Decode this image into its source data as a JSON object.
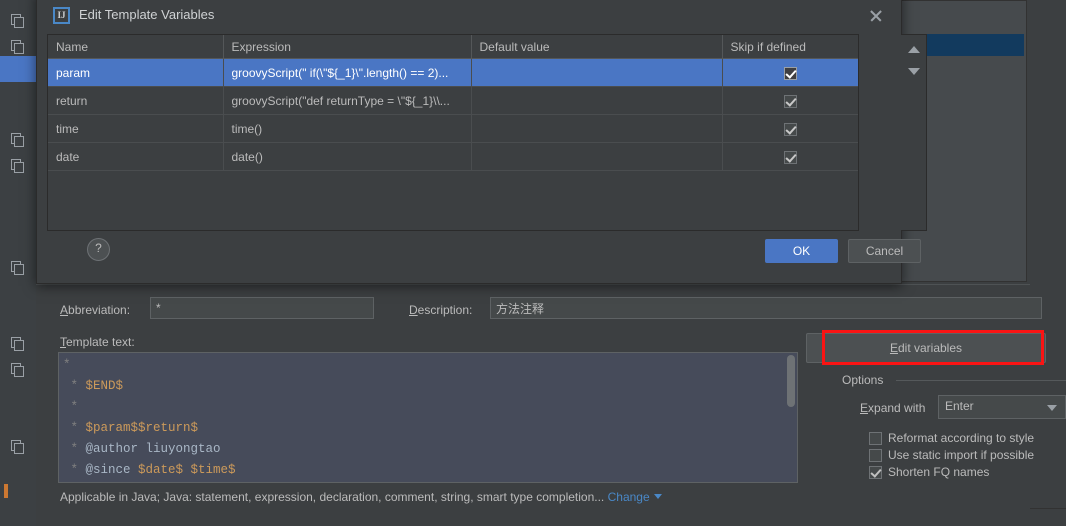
{
  "background": {
    "ghost_text": "",
    "sidebar_icon": "copy-icon"
  },
  "dialog": {
    "title": "Edit Template Variables",
    "icon": "intellij-idea-icon",
    "close_icon": "close-icon",
    "help_label": "?",
    "ok_label": "OK",
    "cancel_label": "Cancel",
    "spinner_up_icon": "chevron-up-icon",
    "spinner_down_icon": "chevron-down-icon",
    "table": {
      "columns": [
        "Name",
        "Expression",
        "Default value",
        "Skip if defined"
      ],
      "rows": [
        {
          "name": "param",
          "expression": "groovyScript(\" if(\\\"${_1}\\\".length() == 2)...",
          "default_value": "",
          "skip_if_defined": true,
          "selected": true
        },
        {
          "name": "return",
          "expression": "groovyScript(\"def returnType = \\\"${_1}\\\\...",
          "default_value": "",
          "skip_if_defined": true,
          "selected": false
        },
        {
          "name": "time",
          "expression": "time()",
          "default_value": "",
          "skip_if_defined": true,
          "selected": false
        },
        {
          "name": "date",
          "expression": "date()",
          "default_value": "",
          "skip_if_defined": true,
          "selected": false
        }
      ]
    }
  },
  "settings": {
    "abbreviation_label": "Abbreviation:",
    "abbreviation_value": "*",
    "description_label": "Description:",
    "description_value": "方法注释",
    "template_text_label": "Template text:",
    "template_lines": [
      {
        "prefix": "*",
        "text": "",
        "var": ""
      },
      {
        "prefix": " * ",
        "text": "",
        "var": "$END$"
      },
      {
        "prefix": " * ",
        "text": "",
        "var": ""
      },
      {
        "prefix": " * ",
        "text": "",
        "var": "$param$$return$"
      },
      {
        "prefix": " * ",
        "text": "@author liuyongtao",
        "var": ""
      },
      {
        "prefix": " * ",
        "text": "@since ",
        "var": "$date$ $time$"
      }
    ],
    "edit_variables_label": "Edit variables",
    "highlight_color": "#fa1414",
    "options": {
      "title": "Options",
      "expand_with_label": "Expand with",
      "expand_with_value": "Enter",
      "checkboxes": [
        {
          "label": "Reformat according to style",
          "checked": false
        },
        {
          "label": "Use static import if possible",
          "checked": false
        },
        {
          "label": "Shorten FQ names",
          "checked": true
        }
      ]
    },
    "applicable_text": "Applicable in Java; Java: statement, expression, declaration, comment, string, smart type completion...",
    "change_label": "Change",
    "change_link_color": "#4a88c7"
  }
}
